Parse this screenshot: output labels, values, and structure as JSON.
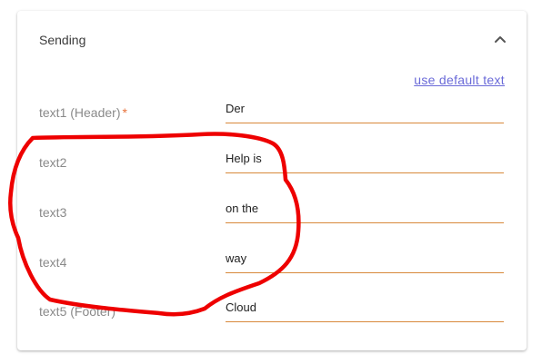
{
  "section": {
    "title": "Sending",
    "default_link": "use default text",
    "fields": [
      {
        "label": "text1 (Header)",
        "required_mark": "*",
        "value": "Der"
      },
      {
        "label": "text2",
        "value": "Help is"
      },
      {
        "label": "text3",
        "value": "on the"
      },
      {
        "label": "text4",
        "value": "way"
      },
      {
        "label": "text5 (Footer)",
        "value": "Cloud"
      }
    ]
  },
  "icons": {
    "collapse": "chevron-up-icon"
  },
  "colors": {
    "accent_underline": "#d8893a",
    "link": "#6a6ad8",
    "required": "#e8733c",
    "annotation": "#ee0000"
  }
}
